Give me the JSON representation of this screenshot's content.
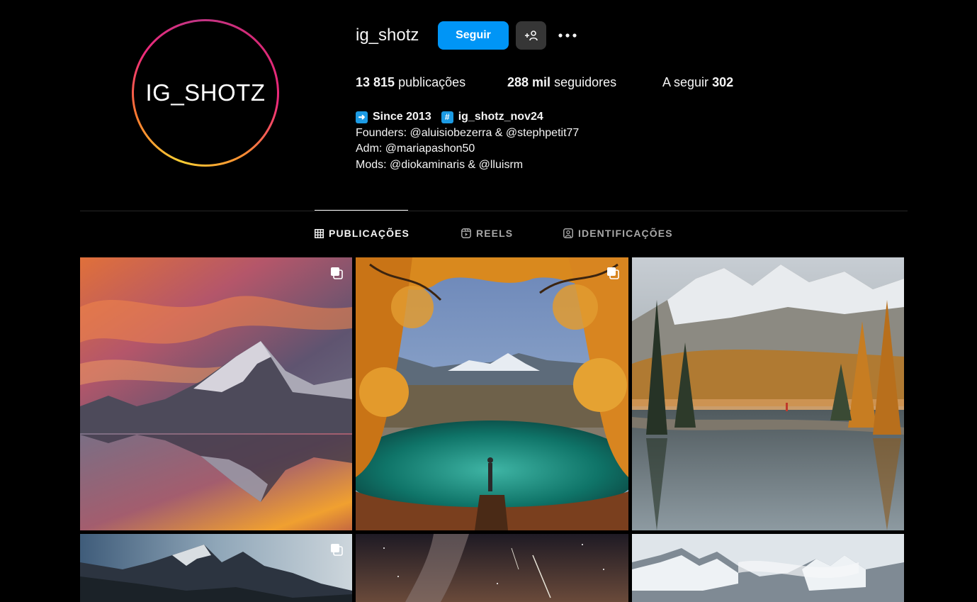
{
  "profile": {
    "avatar_text": "IG_SHOTZ",
    "username": "ig_shotz",
    "follow_label": "Seguir",
    "posts_count": "13 815",
    "posts_label": "publicações",
    "followers_count": "288 mil",
    "followers_label": "seguidores",
    "following_label": "A seguir",
    "following_count": "302"
  },
  "bio": {
    "since": "Since 2013",
    "hashtag_emoji": "#",
    "hashtag": "ig_shotz_nov24",
    "lines": [
      "Founders: @aluisiobezerra & @stephpetit77",
      "Adm: @mariapashon50",
      "Mods: @diokaminaris & @lluisrm"
    ]
  },
  "tabs": [
    {
      "label": "PUBLICAÇÕES",
      "icon": "grid-icon",
      "active": true
    },
    {
      "label": "REELS",
      "icon": "reels-icon",
      "active": false
    },
    {
      "label": "IDENTIFICAÇÕES",
      "icon": "tagged-icon",
      "active": false
    }
  ],
  "posts": [
    {
      "scene": "sunset-mountain-reflection",
      "multi": true
    },
    {
      "scene": "autumn-lake-hiker",
      "multi": true
    },
    {
      "scene": "alpine-lake-autumn-trees",
      "multi": false
    },
    {
      "scene": "jagged-peaks-clouds",
      "multi": true
    },
    {
      "scene": "milky-way-night-sky",
      "multi": false
    },
    {
      "scene": "snowy-dolomites-mist",
      "multi": false
    }
  ],
  "colors": {
    "background": "#000000",
    "follow_button": "#0095f6",
    "secondary_button": "#363636",
    "text_primary": "#f5f5f5",
    "text_secondary": "#a8a8a8"
  }
}
